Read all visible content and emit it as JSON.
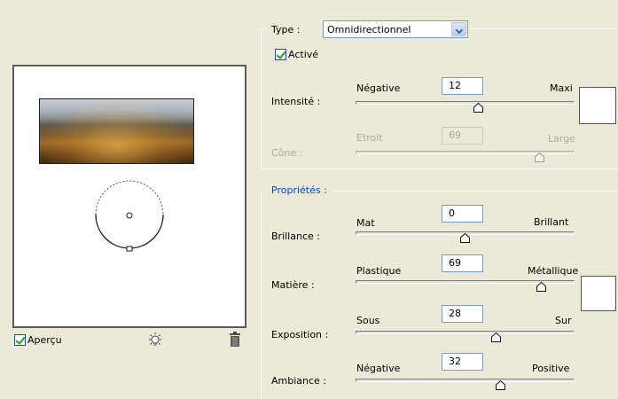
{
  "preview": {
    "checkbox_label": "Aperçu",
    "checked": true
  },
  "type": {
    "label": "Type :",
    "value": "Omnidirectionnel",
    "active_label": "Activé",
    "active_checked": true
  },
  "intensity": {
    "label": "Intensité :",
    "min_label": "Négative",
    "max_label": "Maxi",
    "value": "12",
    "level": 0.56
  },
  "cone": {
    "label": "Cône :",
    "min_label": "Etroit",
    "max_label": "Large",
    "value": "69",
    "level": 0.84
  },
  "properties": {
    "section_label": "Propriétés :",
    "gloss": {
      "label": "Brillance :",
      "min_label": "Mat",
      "max_label": "Brillant",
      "value": "0",
      "level": 0.5
    },
    "material": {
      "label": "Matière :",
      "min_label": "Plastique",
      "max_label": "Métallique",
      "value": "69",
      "level": 0.85
    },
    "exposure": {
      "label": "Exposition :",
      "min_label": "Sous",
      "max_label": "Sur",
      "value": "28",
      "level": 0.64
    },
    "ambience": {
      "label": "Ambiance :",
      "min_label": "Négative",
      "max_label": "Positive",
      "value": "32",
      "level": 0.66
    }
  },
  "colors": {
    "background": "#ece9d8",
    "section_label": "#0046d5",
    "disabled_text": "#a7a6aa",
    "checkmark": "#21a121"
  },
  "icons": [
    "light-bulb-icon",
    "trash-icon",
    "chevron-down-icon",
    "checkmark-icon",
    "slider-thumb-icon"
  ]
}
